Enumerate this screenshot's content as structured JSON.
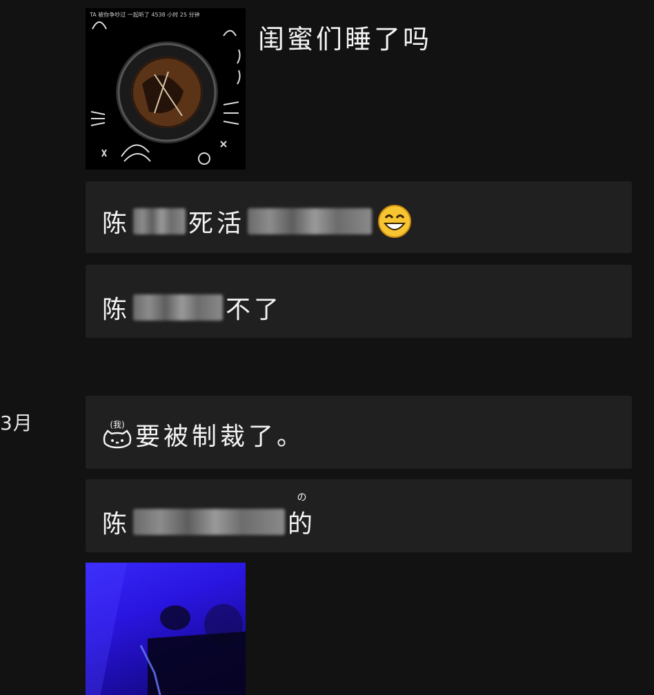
{
  "images": {
    "top": {
      "caption": "TA 被你争吵过 一起听了 4538 小时 25 分钟"
    },
    "bottom": {
      "caption": ""
    }
  },
  "title_line": {
    "text": "闺蜜们睡了吗"
  },
  "date_label": "3月",
  "messages": [
    {
      "prefix": "陈",
      "middle": "死活",
      "suffix": ""
    },
    {
      "prefix": "陈",
      "suffix": "不了"
    },
    {
      "me_label": "(我)",
      "text": "要被制裁了。"
    },
    {
      "prefix": "陈",
      "ruby": "の",
      "suffix": "的"
    }
  ],
  "colors": {
    "background": "#121212",
    "card": "#202020",
    "text": "#f4f4f4",
    "blue_photo": "#2a16e0"
  },
  "icons": {
    "emoji": "grinning-face-icon",
    "me_avatar": "hello-kitty-face-icon"
  }
}
